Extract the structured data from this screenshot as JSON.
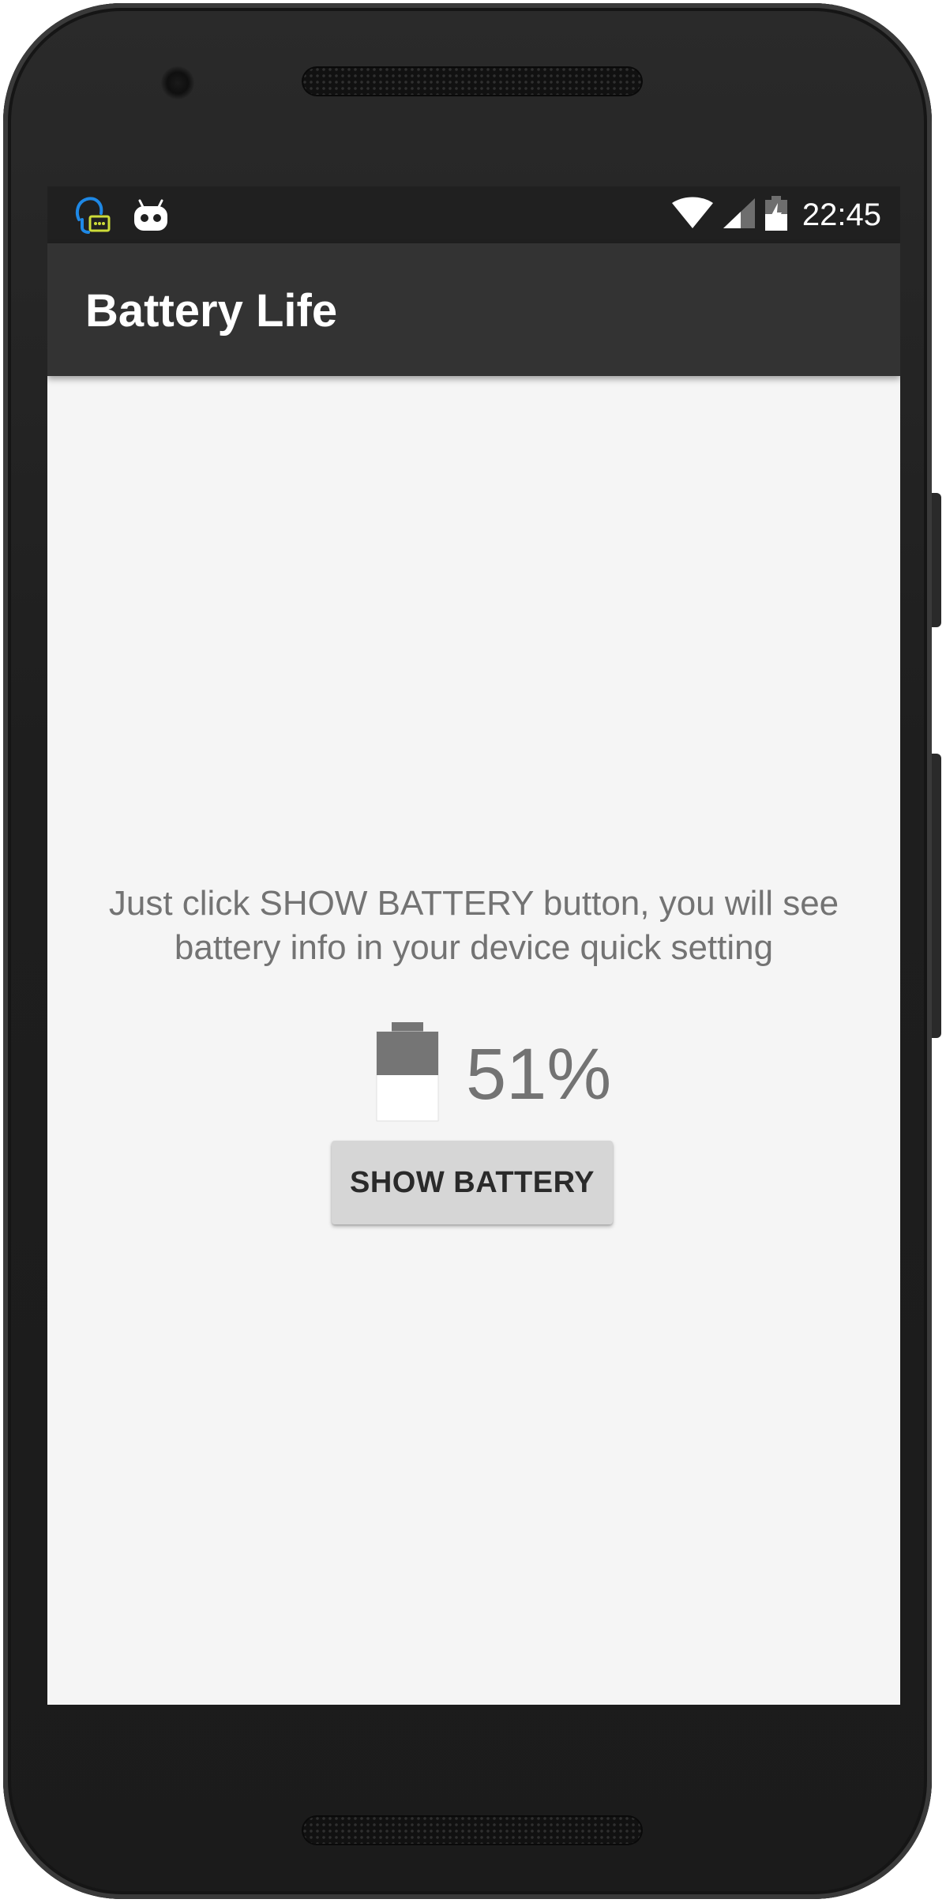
{
  "status_bar": {
    "time": "22:45",
    "left_icons": [
      "headset-chat-icon",
      "robot-mascot-icon"
    ],
    "right_icons": [
      "wifi-icon",
      "cell-signal-icon",
      "battery-charging-icon"
    ]
  },
  "app_bar": {
    "title": "Battery Life"
  },
  "main": {
    "info_line_1": "Just click SHOW BATTERY button, you will see",
    "info_line_2": "battery info in your device quick setting",
    "battery_level": 0.51,
    "battery_percent_text": "51%",
    "show_button_label": "SHOW BATTERY"
  },
  "colors": {
    "status_bar": "#202020",
    "app_bar": "#333333",
    "background": "#f5f5f5",
    "text_gray": "#737373",
    "button": "#d6d6d6"
  }
}
